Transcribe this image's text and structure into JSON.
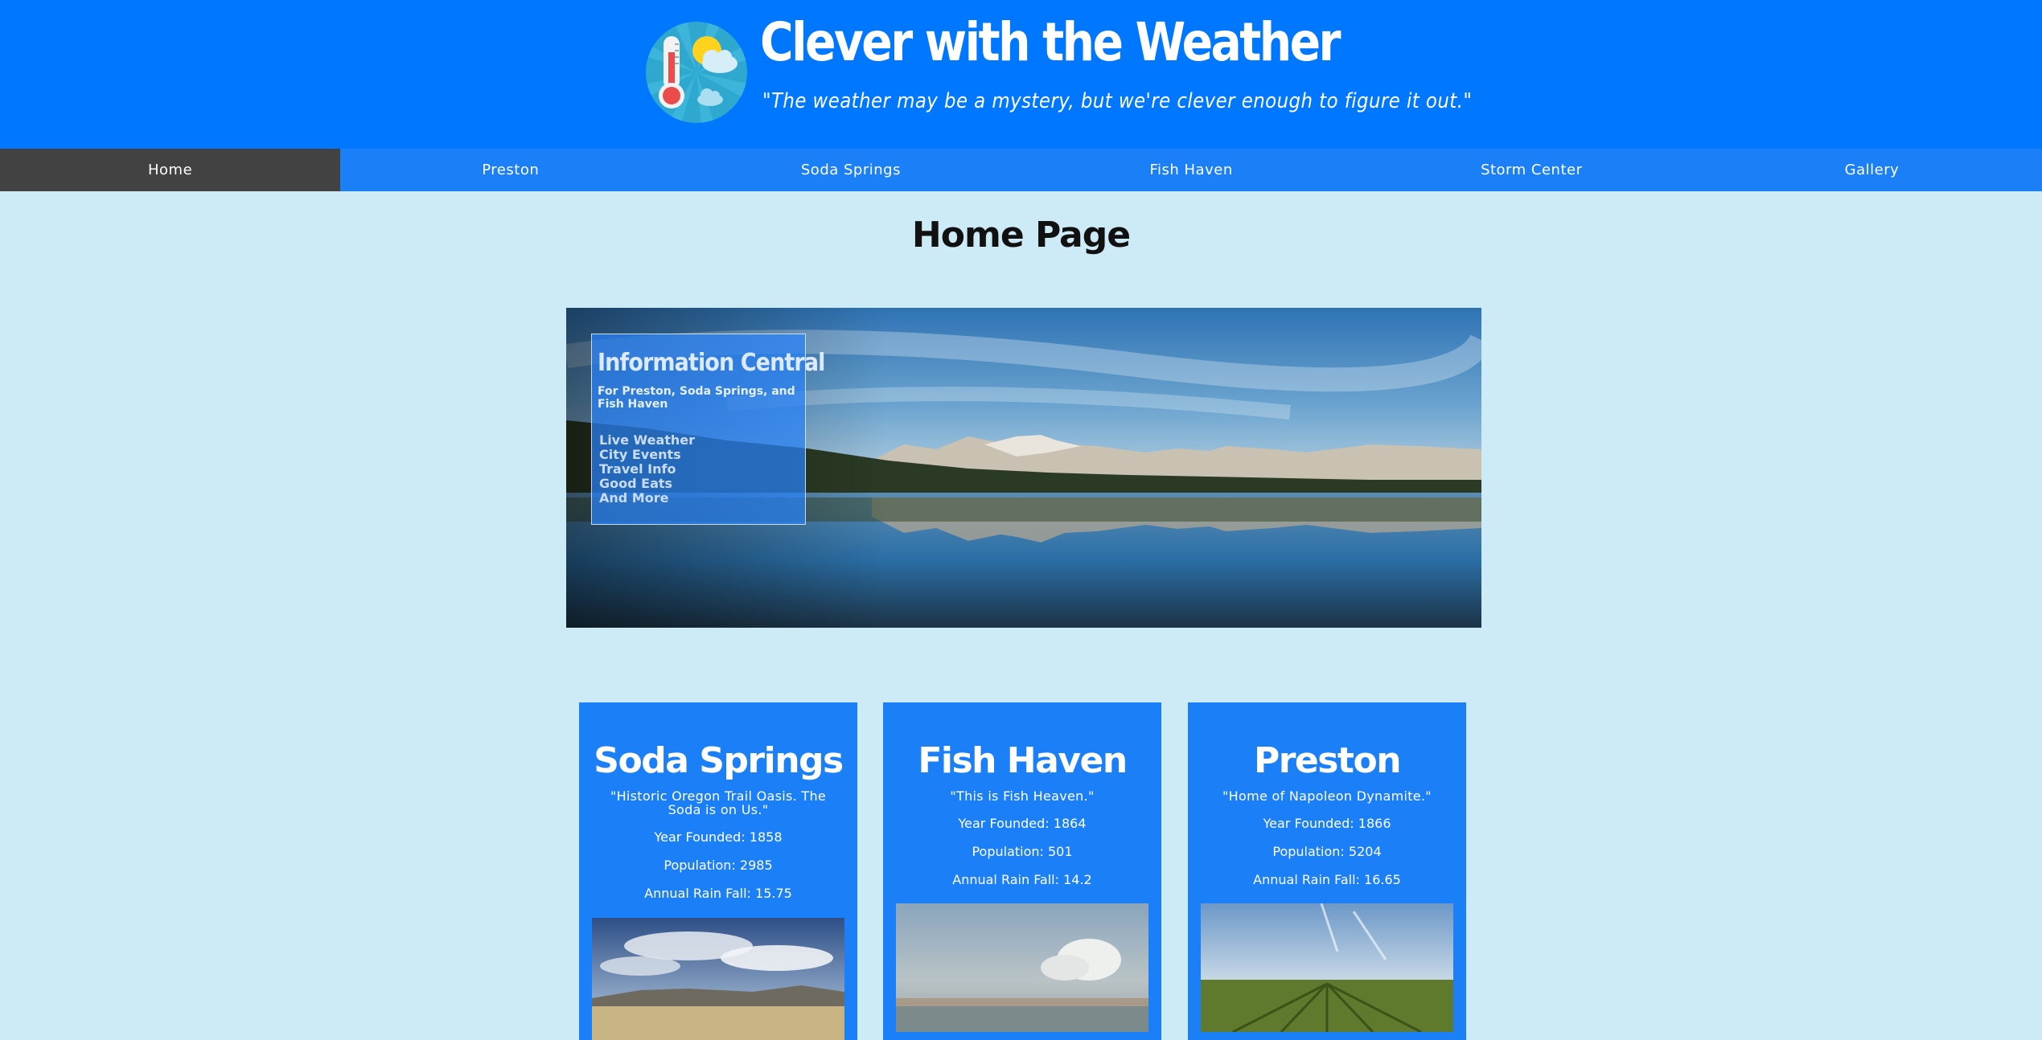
{
  "header": {
    "site_title": "Clever with the Weather",
    "tagline": "\"The weather may be a mystery, but we're clever enough to figure it out.\"",
    "logo_icon": "thermometer-sun-cloud-icon"
  },
  "nav": {
    "items": [
      {
        "label": "Home",
        "active": true
      },
      {
        "label": "Preston",
        "active": false
      },
      {
        "label": "Soda Springs",
        "active": false
      },
      {
        "label": "Fish Haven",
        "active": false
      },
      {
        "label": "Storm Center",
        "active": false
      },
      {
        "label": "Gallery",
        "active": false
      }
    ]
  },
  "main": {
    "page_title": "Home Page",
    "hero": {
      "title": "Information Central",
      "subtitle": "For Preston, Soda Springs, and Fish Haven",
      "links": [
        "Live Weather",
        "City Events",
        "Travel Info",
        "Good Eats",
        "And More"
      ]
    },
    "cards": [
      {
        "name": "Soda Springs",
        "quote": "\"Historic Oregon Trail Oasis. The Soda is on Us.\"",
        "founded": "Year Founded: 1858",
        "population": "Population: 2985",
        "rainfall": "Annual Rain Fall: 15.75"
      },
      {
        "name": "Fish Haven",
        "quote": "\"This is Fish Heaven.\"",
        "founded": "Year Founded: 1864",
        "population": "Population: 501",
        "rainfall": "Annual Rain Fall: 14.2"
      },
      {
        "name": "Preston",
        "quote": "\"Home of Napoleon Dynamite.\"",
        "founded": "Year Founded: 1866",
        "population": "Population: 5204",
        "rainfall": "Annual Rain Fall: 16.65"
      }
    ]
  },
  "colors": {
    "header_bg": "#0077ff",
    "nav_bg": "#1b7ff7",
    "nav_active_bg": "#424242",
    "page_bg": "#cdebf6"
  }
}
